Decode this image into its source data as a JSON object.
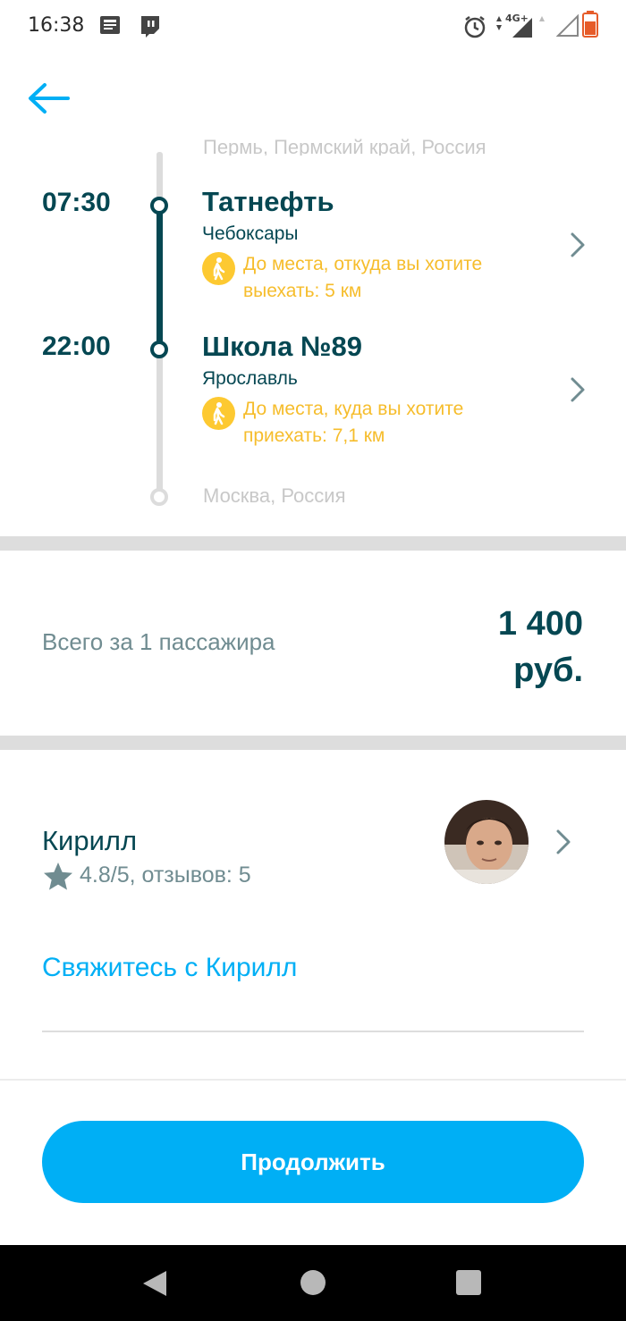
{
  "status_bar": {
    "time": "16:38",
    "network": "4G+"
  },
  "route": {
    "origin_city": "Пермь, Пермский край, Россия",
    "stops": [
      {
        "time": "07:30",
        "title": "Татнефть",
        "city": "Чебоксары",
        "walk_note": "До места, откуда вы хотите выехать: 5 км"
      },
      {
        "time": "22:00",
        "title": "Школа №89",
        "city": "Ярославль",
        "walk_note": "До места, куда вы хотите приехать: 7,1 км"
      }
    ],
    "destination_city": "Москва, Россия"
  },
  "price": {
    "label": "Всего за 1 пассажира",
    "amount": "1 400",
    "currency": "руб."
  },
  "driver": {
    "name": "Кирилл",
    "rating": "4.8/5, отзывов: 5",
    "contact_label": "Свяжитесь с Кирилл"
  },
  "actions": {
    "continue_label": "Продолжить"
  },
  "colors": {
    "primary": "#00aff5",
    "text_dark": "#054752",
    "text_muted": "#708c91",
    "walk_accent": "#fdc931"
  }
}
